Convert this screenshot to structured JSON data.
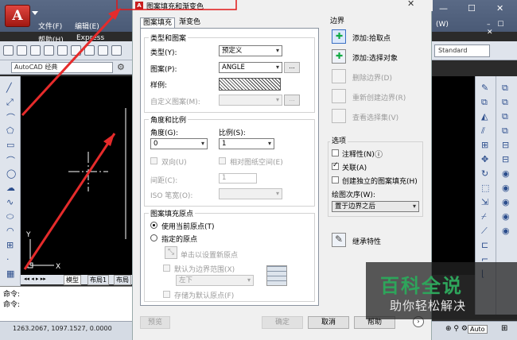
{
  "cad": {
    "app_icon_letter": "A",
    "menu_row1": [
      "文件(F)",
      "编辑(E)",
      "(W)"
    ],
    "menu_row2": [
      "帮助(H)",
      "Express"
    ],
    "workspace": "AutoCAD 经典",
    "standard_label": "Standard",
    "tabs": [
      "模型",
      "布局1",
      "布局"
    ],
    "command_lines": [
      "命令:",
      "命令:"
    ],
    "coordinates": "1263.2067, 1097.1527, 0.0000",
    "status_auto": "Auto",
    "axis_y": "Y",
    "axis_x": "X"
  },
  "dialog": {
    "title": "图案填充和渐变色",
    "app_icon": "A",
    "tabs": [
      "图案填充",
      "渐变色"
    ],
    "type_group": {
      "title": "类型和图案",
      "type_label": "类型(Y):",
      "type_value": "预定义",
      "pattern_label": "图案(P):",
      "pattern_value": "ANGLE",
      "dots": "...",
      "sample_label": "样例:",
      "custom_label": "自定义图案(M):"
    },
    "angle_group": {
      "title": "角度和比例",
      "angle_label": "角度(G):",
      "angle_value": "0",
      "scale_label": "比例(S):",
      "scale_value": "1",
      "double_label": "双向(U)",
      "relative_label": "相对图纸空间(E)",
      "spacing_label": "间距(C):",
      "spacing_value": "1",
      "iso_label": "ISO 笔宽(O):"
    },
    "origin_group": {
      "title": "图案填充原点",
      "use_current": "使用当前原点(T)",
      "specified": "指定的原点",
      "click_set": "单击以设置新原点",
      "default_extent": "默认为边界范围(X)",
      "position_value": "左下",
      "store_default": "存储为默认原点(F)"
    },
    "boundary": {
      "title": "边界",
      "add_pick": "添加:拾取点",
      "add_select": "添加:选择对象",
      "remove": "删除边界(D)",
      "recreate": "重新创建边界(R)",
      "view_sel": "查看选择集(V)"
    },
    "options": {
      "title": "选项",
      "annotative": "注释性(N)",
      "associative": "关联(A)",
      "separate": "创建独立的图案填充(H)",
      "draw_order_label": "绘图次序(W):",
      "draw_order_value": "置于边界之后"
    },
    "inherit": "继承特性",
    "buttons": {
      "preview": "预览",
      "ok": "确定",
      "cancel": "取消",
      "help": "帮助"
    }
  },
  "watermark": {
    "line1": "百科全说",
    "line2": "助你轻松解决"
  }
}
